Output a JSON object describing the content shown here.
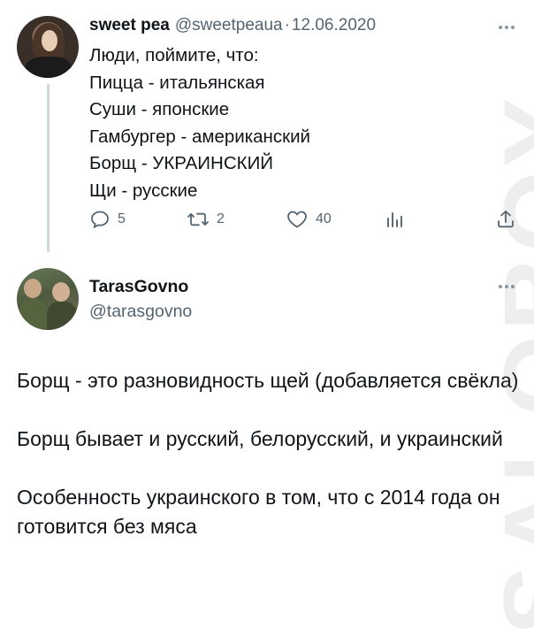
{
  "tweet1": {
    "author_name": "sweet pea",
    "handle": "@sweetpeaua",
    "separator": "·",
    "date": "12.06.2020",
    "lines": [
      "Люди, поймите, что:",
      "Пицца - итальянская",
      "Суши - японские",
      "Гамбургер - американский",
      "Борщ - УКРАИНСКИЙ",
      "Щи - русские"
    ],
    "actions": {
      "reply_count": "5",
      "retweet_count": "2",
      "like_count": "40"
    }
  },
  "tweet2": {
    "author_name": "TarasGovno",
    "handle": "@tarasgovno",
    "paragraphs": [
      "Борщ - это разновидность щей (добавляется свёкла)",
      "Борщ бывает и русский, белорусский, и украинский",
      "Особенность украинского в том, что с 2014 года он готовится без мяса"
    ]
  },
  "watermark": "SALOBOY",
  "colors": {
    "text": "#0f1419",
    "secondary": "#536471",
    "thread_line": "#cfd9de"
  },
  "icons": {
    "reply": "reply-icon",
    "retweet": "retweet-icon",
    "like": "heart-icon",
    "views": "views-icon",
    "share": "share-icon",
    "more": "more-icon"
  }
}
